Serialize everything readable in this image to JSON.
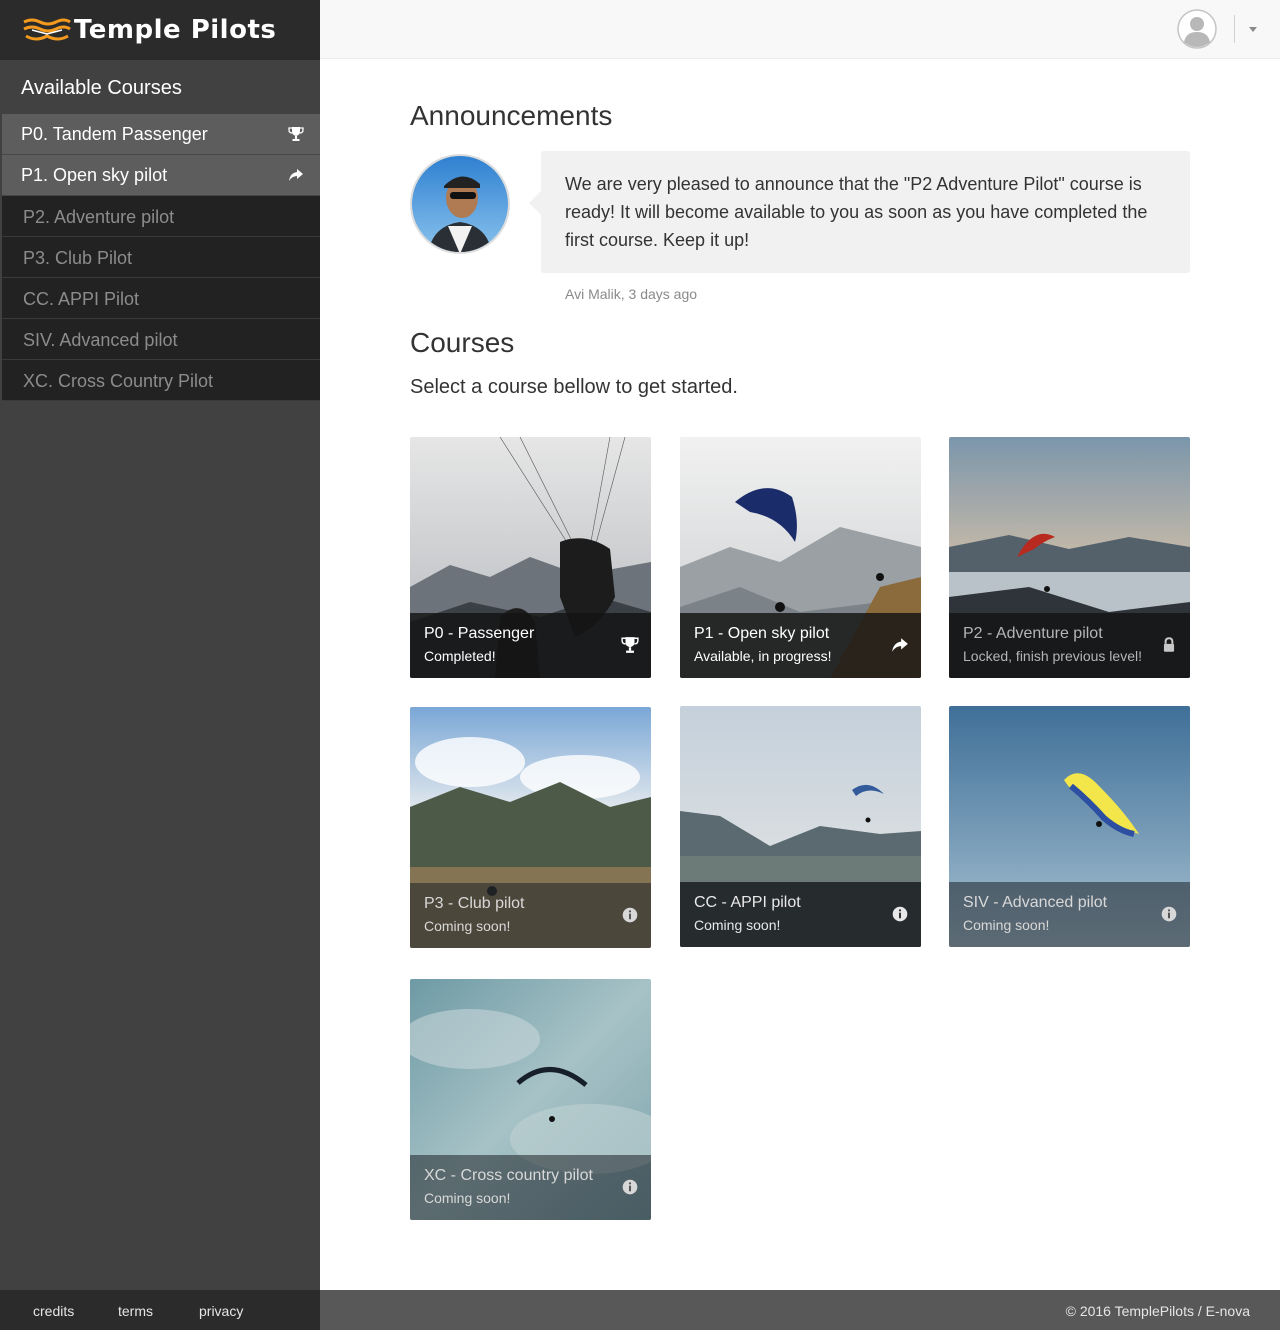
{
  "brand": {
    "name": "Temple Pilots",
    "accent": "#f39a1e"
  },
  "sidebar": {
    "heading": "Available Courses",
    "items": [
      {
        "label": "P0. Tandem Passenger",
        "state": "completed",
        "icon": "trophy-icon"
      },
      {
        "label": "P1. Open sky pilot",
        "state": "in-progress",
        "icon": "share-arrow-icon"
      },
      {
        "label": "P2. Adventure pilot",
        "state": "disabled"
      },
      {
        "label": "P3. Club Pilot",
        "state": "disabled"
      },
      {
        "label": "CC. APPI Pilot",
        "state": "disabled"
      },
      {
        "label": "SIV. Advanced pilot",
        "state": "disabled"
      },
      {
        "label": "XC. Cross Country Pilot",
        "state": "disabled"
      }
    ],
    "footer_links": [
      "credits",
      "terms",
      "privacy"
    ]
  },
  "topbar": {
    "avatar_icon": "user-avatar-icon",
    "dropdown_icon": "caret-down-icon"
  },
  "announcements": {
    "title": "Announcements",
    "message": "We are very pleased to announce that the \"P2 Adventure Pilot\" course is ready! It will become available to you as soon as you have completed the first course. Keep it up!",
    "meta": "Avi Malik, 3 days ago"
  },
  "courses": {
    "title": "Courses",
    "subtitle": "Select a course bellow to get started.",
    "cards": [
      {
        "title": "P0 - Passenger",
        "status": "Completed!",
        "icon": "trophy-icon"
      },
      {
        "title": "P1 - Open sky pilot",
        "status": "Available, in progress!",
        "icon": "share-arrow-icon"
      },
      {
        "title": "P2 - Adventure pilot",
        "status": "Locked, finish previous level!",
        "icon": "lock-icon"
      },
      {
        "title": "P3 - Club pilot",
        "status": "Coming soon!",
        "icon": "info-icon"
      },
      {
        "title": "CC - APPI pilot",
        "status": "Coming soon!",
        "icon": "info-icon"
      },
      {
        "title": "SIV - Advanced pilot",
        "status": "Coming soon!",
        "icon": "info-icon"
      },
      {
        "title": "XC - Cross country pilot",
        "status": "Coming soon!",
        "icon": "info-icon"
      }
    ]
  },
  "footer": {
    "copyright": "© 2016 TemplePilots / E-nova"
  }
}
